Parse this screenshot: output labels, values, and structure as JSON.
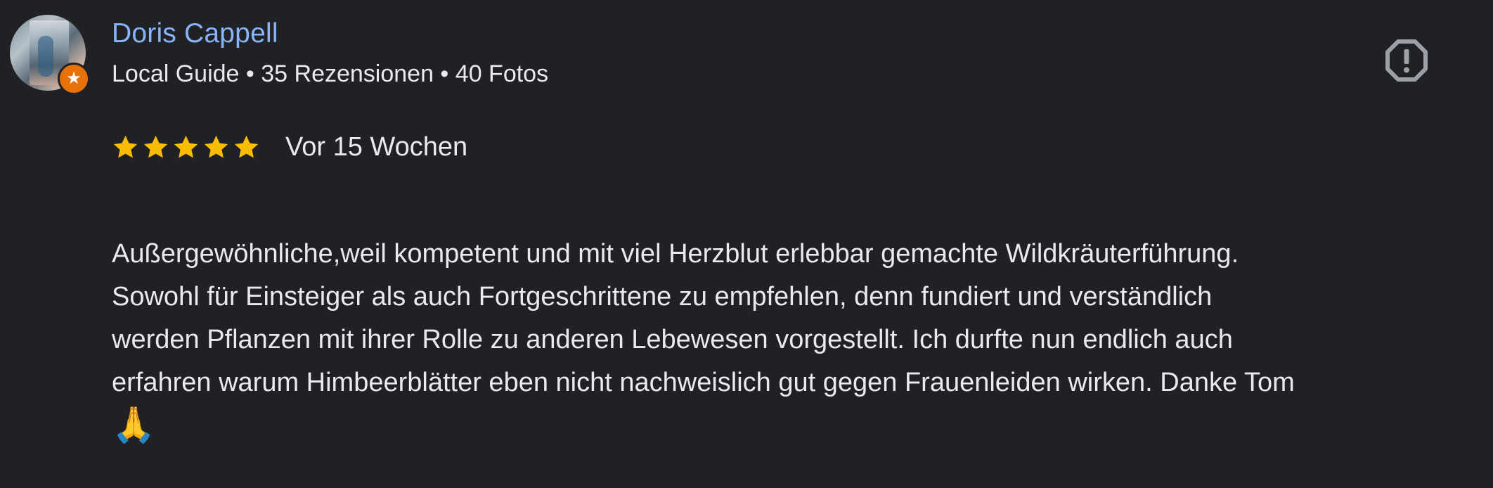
{
  "reviewer": {
    "name": "Doris Cappell",
    "meta": "Local Guide • 35 Rezensionen • 40 Fotos"
  },
  "badge_icon": "local-guide-star-icon",
  "report_icon": "report-icon",
  "review": {
    "rating": 5,
    "rating_max": 5,
    "date": "Vor 15 Wochen",
    "text": "Außergewöhnliche,weil kompetent und mit viel Herzblut erlebbar gemachte Wildkräuterführung.\nSowohl für Einsteiger als auch Fortgeschrittene zu empfehlen, denn fundiert und verständlich\nwerden Pflanzen mit ihrer Rolle zu anderen Lebewesen vorgestellt. Ich durfte nun endlich auch\nerfahren warum Himbeerblätter eben nicht nachweislich gut gegen Frauenleiden wirken. Danke Tom",
    "emoji": "🙏"
  },
  "colors": {
    "background": "#202124",
    "name": "#8ab4f8",
    "text": "#e8eaed",
    "star": "#fbbc04",
    "badge": "#e8710a",
    "icon": "#9aa0a6"
  }
}
